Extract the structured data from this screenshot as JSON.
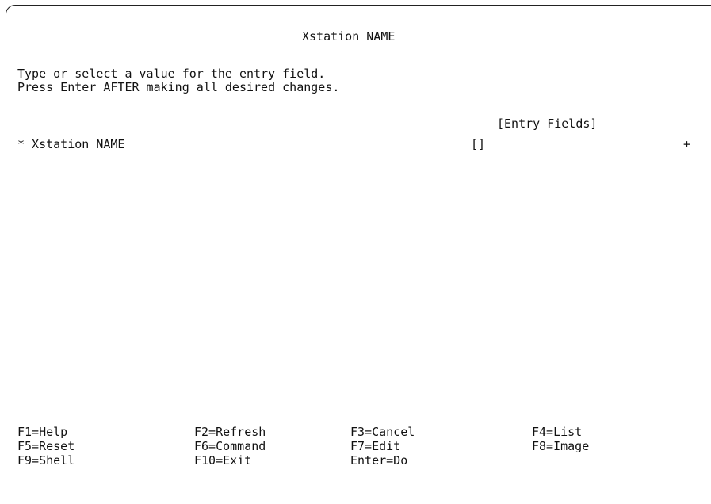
{
  "screen": {
    "title": "Xstation NAME",
    "instructions": [
      "Type or select a value for the entry field.",
      "Press Enter AFTER making all desired changes."
    ],
    "entry_fields_header": "[Entry Fields]",
    "field": {
      "required_marker": "*",
      "label": "* Xstation NAME",
      "value_display": "[]",
      "list_indicator": "+"
    }
  },
  "function_keys": [
    [
      "F1=Help",
      "F2=Refresh",
      "F3=Cancel",
      "F4=List"
    ],
    [
      "F5=Reset",
      "F6=Command",
      "F7=Edit",
      "F8=Image"
    ],
    [
      "F9=Shell",
      "F10=Exit",
      "Enter=Do",
      ""
    ]
  ]
}
